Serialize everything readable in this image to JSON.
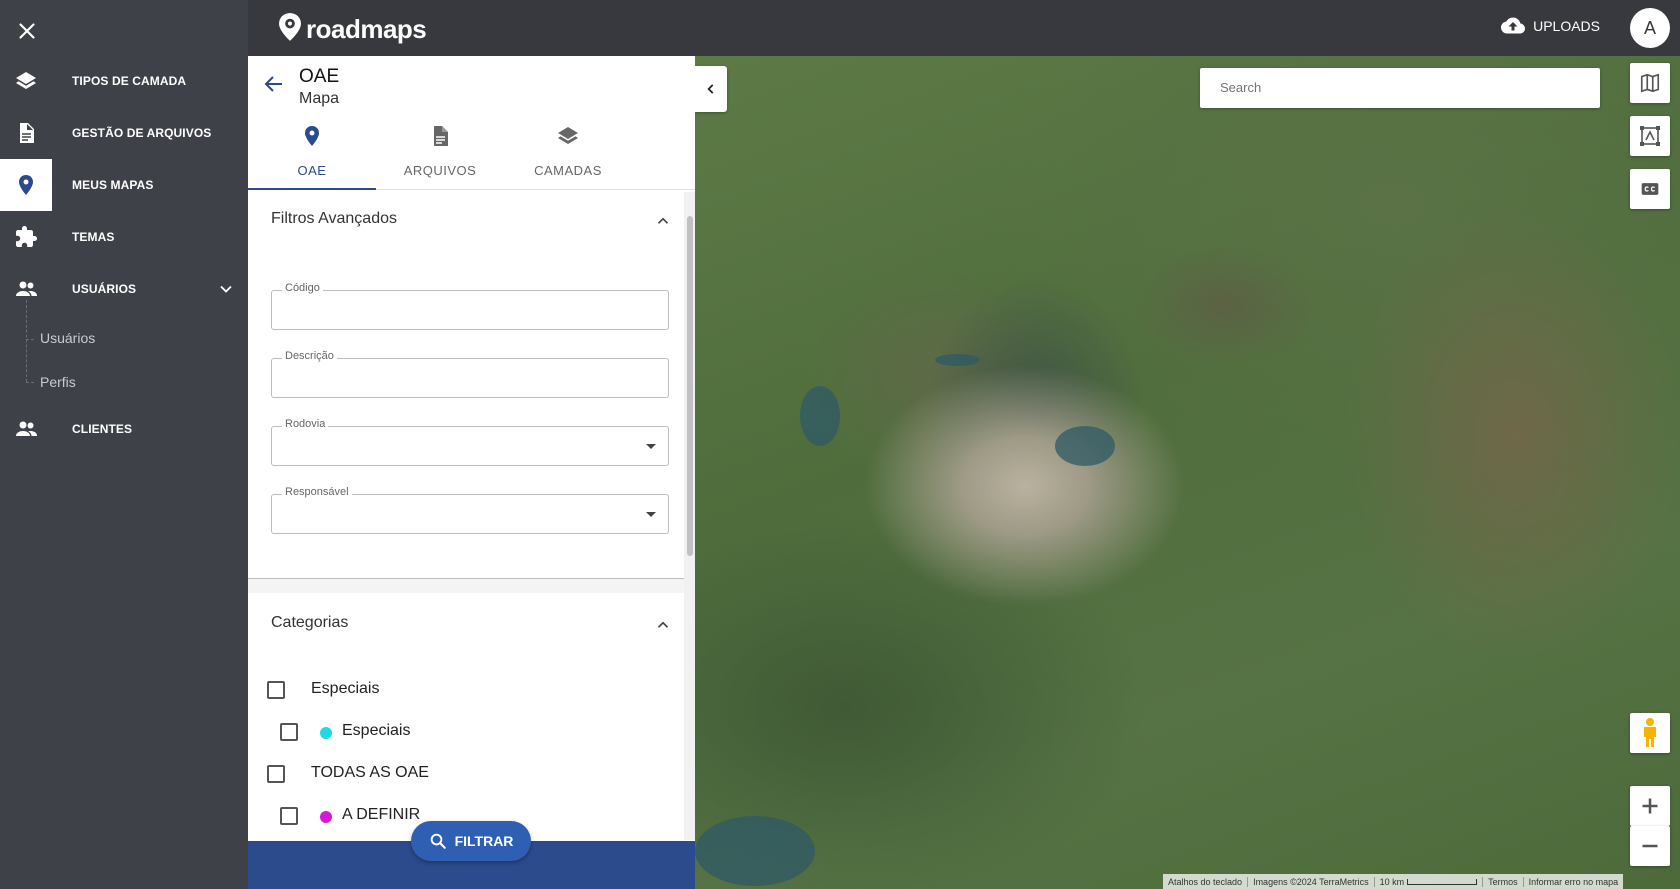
{
  "nav": {
    "items": [
      {
        "label": "TIPOS DE CAMADA",
        "icon": "layers-icon"
      },
      {
        "label": "GESTÃO DE ARQUIVOS",
        "icon": "file-icon"
      },
      {
        "label": "MEUS MAPAS",
        "icon": "map-pin-icon",
        "active": true
      },
      {
        "label": "TEMAS",
        "icon": "puzzle-icon"
      },
      {
        "label": "USUÁRIOS",
        "icon": "users-icon",
        "expanded": true
      },
      {
        "label": "CLIENTES",
        "icon": "users-icon"
      }
    ],
    "subitems": [
      "Usuários",
      "Perfis"
    ]
  },
  "topbar": {
    "logo": "roadmaps",
    "uploads_label": "UPLOADS",
    "avatar_initial": "A"
  },
  "panel": {
    "title": "OAE",
    "subtitle": "Mapa",
    "tabs": [
      {
        "label": "OAE",
        "icon": "map-pin-icon",
        "active": true
      },
      {
        "label": "ARQUIVOS",
        "icon": "file-icon"
      },
      {
        "label": "CAMADAS",
        "icon": "layers-icon"
      }
    ],
    "filters": {
      "title": "Filtros Avançados",
      "fields": [
        {
          "label": "Código",
          "value": ""
        },
        {
          "label": "Descrição",
          "value": ""
        },
        {
          "label": "Rodovia",
          "value": "",
          "type": "select"
        },
        {
          "label": "Responsável",
          "value": "",
          "type": "select"
        }
      ]
    },
    "categories": {
      "title": "Categorias",
      "items": [
        {
          "label": "Especiais",
          "checked": false
        },
        {
          "label": "Especiais",
          "checked": false,
          "color": "#1fd8e8"
        },
        {
          "label": "TODAS AS OAE",
          "checked": false
        },
        {
          "label": "A DEFINIR",
          "checked": false,
          "color": "#d21ad8"
        }
      ]
    },
    "filter_button": "FILTRAR"
  },
  "map": {
    "search_placeholder": "Search",
    "attribution": [
      "Atalhos do teclado",
      "Imagens ©2024 TerraMetrics",
      "10 km",
      "Termos",
      "Informar erro no mapa"
    ]
  },
  "colors": {
    "accent": "#2c4b8c",
    "nav_bg": "#3e4148",
    "topbar_bg": "#37393f"
  }
}
